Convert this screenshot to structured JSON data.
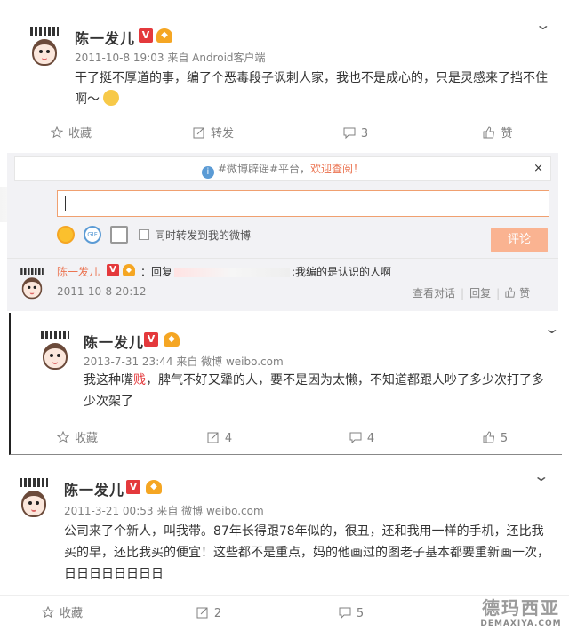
{
  "posts": [
    {
      "user": "陈一发儿",
      "meta": "2011-10-8 19:03 来自 Android客户端",
      "text": "干了挺不厚道的事，编了个恶毒段子讽刺人家，我也不是成心的，只是灵感来了挡不住啊～",
      "actions": {
        "fav": "收藏",
        "repost": "转发",
        "comment": "3",
        "like": "赞"
      }
    },
    {
      "user": "陈一发儿",
      "meta": "2013-7-31 23:44 来自 微博 weibo.com",
      "text_before": "我这种嘴",
      "text_highlight": "贱",
      "text_after": "，脾气不好又犟的人，要不是因为太懒，不知道都跟人吵了多少次打了多少次架了",
      "actions": {
        "fav": "收藏",
        "repost": "4",
        "comment": "4",
        "like": "5"
      }
    },
    {
      "user": "陈一发儿",
      "meta": "2011-3-21 00:53 来自 微博 weibo.com",
      "text": "公司来了个新人，叫我带。87年长得跟78年似的，很丑，还和我用一样的手机，还比我买的早，还比我买的便宜！这些都不是重点，妈的他画过的图老子基本都要重新画一次，日日日日日日日日",
      "actions": {
        "fav": "收藏",
        "repost": "2",
        "comment": "5",
        "like": ""
      }
    }
  ],
  "comment_box": {
    "notice_text": "#微博辟谣#平台，",
    "notice_link": "欢迎查阅！",
    "close": "×",
    "repost_label": "同时转发到我的微博",
    "submit": "评论"
  },
  "reply": {
    "name": "陈一发儿",
    "prefix": "：回复",
    "text": ":我编的是认识的人啊",
    "time": "2011-10-8 20:12",
    "view": "查看对话",
    "reply": "回复",
    "like": "赞"
  },
  "watermark": {
    "cn": "德玛西亚",
    "en": "DEMAXIYA.COM"
  },
  "colors": {
    "accent": "#eb7350",
    "vip": "#e4393c",
    "submit": "#fab391",
    "meta": "#808080"
  }
}
